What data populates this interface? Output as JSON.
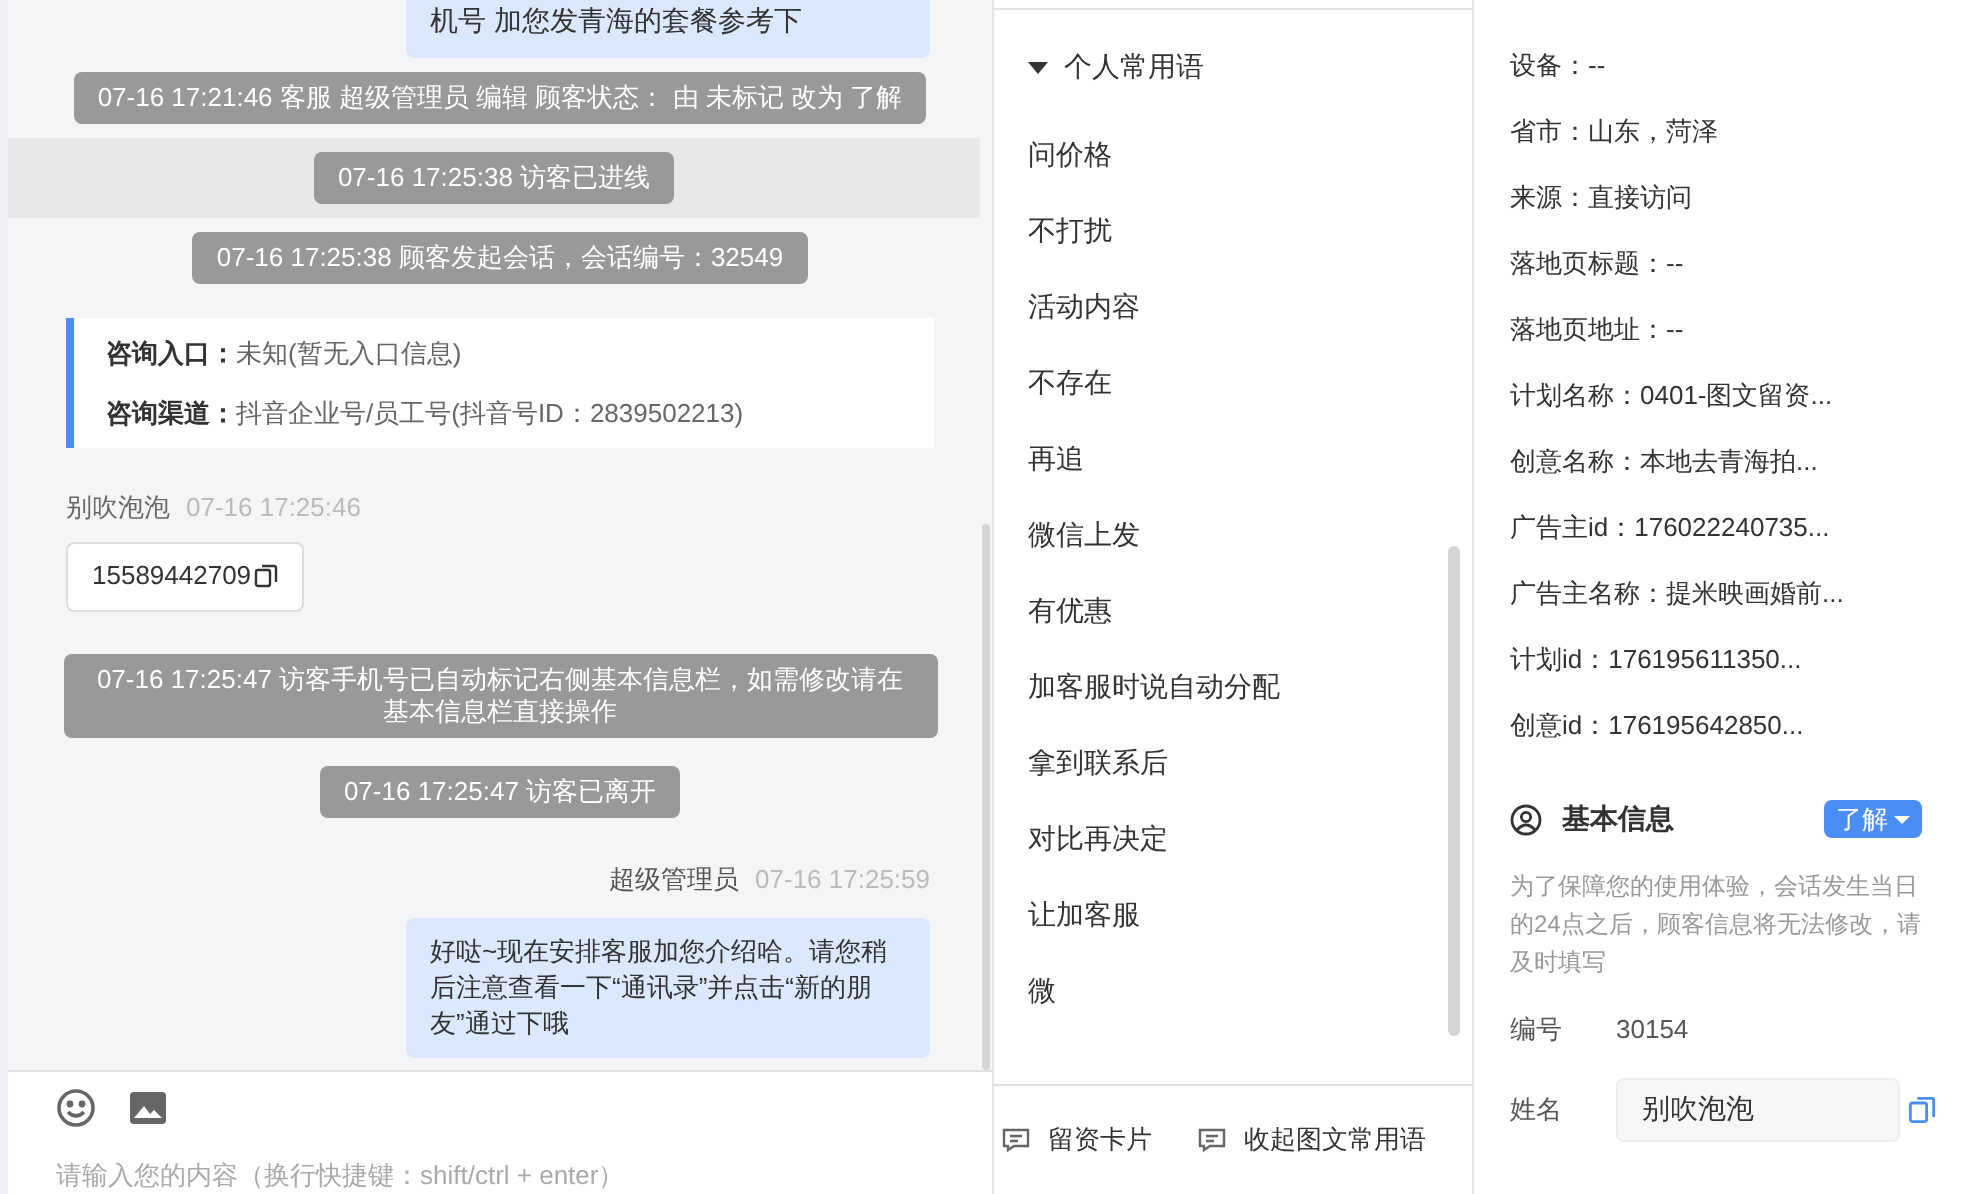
{
  "chat": {
    "messages": [
      {
        "kind": "bubble",
        "text": "机号 加您发青海的套餐参考下"
      },
      {
        "kind": "system",
        "text": "07-16 17:21:46 客服 超级管理员 编辑 顾客状态： 由 未标记 改为 了解",
        "highlighted": false
      },
      {
        "kind": "system",
        "text": "07-16 17:25:38 访客已进线",
        "highlighted": true
      },
      {
        "kind": "system",
        "text": "07-16 17:25:38 顾客发起会话，会话编号：32549",
        "highlighted": false
      },
      {
        "kind": "info",
        "rows": [
          {
            "label": "咨询入口：",
            "value": "未知(暂无入口信息)"
          },
          {
            "label": "咨询渠道：",
            "value": "抖音企业号/员工号(抖音号ID：2839502213)"
          }
        ]
      },
      {
        "kind": "visitor",
        "sender": "别吹泡泡",
        "time": "07-16 17:25:46",
        "text": "15589442709"
      },
      {
        "kind": "system",
        "text": "07-16 17:25:47 访客手机号已自动标记右侧基本信息栏，如需修改请在基本信息栏直接操作",
        "highlighted": false
      },
      {
        "kind": "system",
        "text": "07-16 17:25:47 访客已离开",
        "highlighted": false
      },
      {
        "kind": "agent",
        "sender": "超级管理员",
        "time": "07-16 17:25:59",
        "text": "好哒~现在安排客服加您介绍哈。请您稍后注意查看一下“通讯录”并点击“新的朋友”通过下哦"
      }
    ],
    "input": {
      "placeholder": "请输入您的内容（换行快捷键：shift/ctrl + enter）"
    }
  },
  "phrases": {
    "group": {
      "title": "个人常用语",
      "expanded": true
    },
    "items": [
      "问价格",
      "不打扰",
      "活动内容",
      "不存在",
      "再追",
      "微信上发",
      "有优惠",
      "加客服时说自动分配",
      "拿到联系后",
      "对比再决定",
      "让加客服",
      "微"
    ],
    "buttons": [
      "留资卡片",
      "收起图文常用语"
    ]
  },
  "visitor": {
    "fields": [
      "设备：--",
      "省市：山东，菏泽",
      "来源：直接访问",
      "落地页标题：--",
      "落地页地址：--",
      "计划名称：0401-图文留资...",
      "创意名称：本地去青海拍...",
      "广告主id：176022240735...",
      "广告主名称：提米映画婚前...",
      "计划id：176195611350...",
      "创意id：176195642850..."
    ]
  },
  "basic_info": {
    "title": "基本信息",
    "status": "了解",
    "note": "为了保障您的使用体验，会话发生当日的24点之后，顾客信息将无法修改，请及时填写",
    "id_label": "编号",
    "id_value": "30154",
    "name_label": "姓名",
    "name_value": "别吹泡泡"
  }
}
